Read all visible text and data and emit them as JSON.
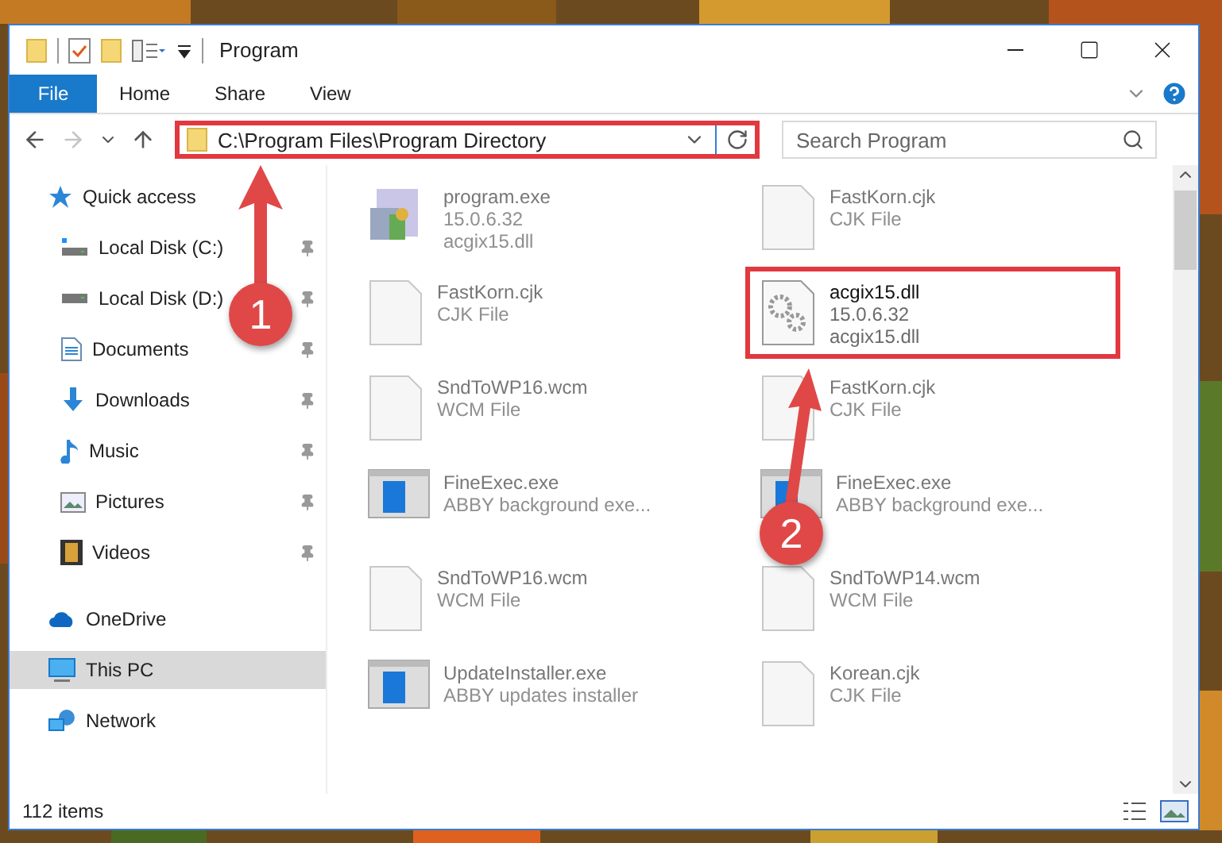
{
  "window": {
    "title": "Program"
  },
  "ribbon": {
    "tabs": [
      {
        "label": "File",
        "selected": true
      },
      {
        "label": "Home",
        "selected": false
      },
      {
        "label": "Share",
        "selected": false
      },
      {
        "label": "View",
        "selected": false
      }
    ]
  },
  "address": {
    "path": "C:\\Program Files\\Program Directory",
    "highlighted": true,
    "forward_disabled": true
  },
  "search": {
    "placeholder": "Search Program"
  },
  "sidebar": {
    "items": [
      {
        "label": "Quick access",
        "kind": "star",
        "selected": false,
        "children": [
          {
            "label": "Local Disk (C:)",
            "kind": "disk-win",
            "pinned": true,
            "selected": false
          },
          {
            "label": "Local Disk (D:)",
            "kind": "disk",
            "pinned": true,
            "selected": false
          },
          {
            "label": "Documents",
            "kind": "docs",
            "pinned": true,
            "selected": false
          },
          {
            "label": "Downloads",
            "kind": "download",
            "pinned": true,
            "selected": false
          },
          {
            "label": "Music",
            "kind": "music",
            "pinned": true,
            "selected": false
          },
          {
            "label": "Pictures",
            "kind": "pictures",
            "pinned": true,
            "selected": false
          },
          {
            "label": "Videos",
            "kind": "videos",
            "pinned": true,
            "selected": false
          }
        ]
      },
      {
        "label": "OneDrive",
        "kind": "cloud",
        "selected": false
      },
      {
        "label": "This PC",
        "kind": "pc",
        "selected": true
      },
      {
        "label": "Network",
        "kind": "network",
        "selected": false
      }
    ]
  },
  "files": [
    {
      "name": "program.exe",
      "lines": [
        "15.0.6.32",
        "acgix15.dll"
      ],
      "kind": "installer",
      "dimmed": true,
      "highlighted": false
    },
    {
      "name": "FastKorn.cjk",
      "lines": [
        "CJK File"
      ],
      "kind": "blank",
      "dimmed": true,
      "highlighted": false
    },
    {
      "name": "FastKorn.cjk",
      "lines": [
        "CJK File"
      ],
      "kind": "blank",
      "dimmed": true,
      "highlighted": false
    },
    {
      "name": "acgix15.dll",
      "lines": [
        "15.0.6.32",
        "acgix15.dll"
      ],
      "kind": "gear",
      "dimmed": false,
      "highlighted": true
    },
    {
      "name": "SndToWP16.wcm",
      "lines": [
        "WCM File"
      ],
      "kind": "blank",
      "dimmed": true,
      "highlighted": false
    },
    {
      "name": "FastKorn.cjk",
      "lines": [
        "CJK File"
      ],
      "kind": "blank",
      "dimmed": true,
      "highlighted": false
    },
    {
      "name": "FineExec.exe",
      "lines": [
        "ABBY background exe..."
      ],
      "kind": "app",
      "dimmed": true,
      "highlighted": false
    },
    {
      "name": "FineExec.exe",
      "lines": [
        "ABBY background exe..."
      ],
      "kind": "app",
      "dimmed": true,
      "highlighted": false
    },
    {
      "name": "SndToWP16.wcm",
      "lines": [
        "WCM File"
      ],
      "kind": "blank",
      "dimmed": true,
      "highlighted": false
    },
    {
      "name": "SndToWP14.wcm",
      "lines": [
        "WCM File"
      ],
      "kind": "blank",
      "dimmed": true,
      "highlighted": false
    },
    {
      "name": "UpdateInstaller.exe",
      "lines": [
        "ABBY updates installer"
      ],
      "kind": "app",
      "dimmed": true,
      "highlighted": false
    },
    {
      "name": "Korean.cjk",
      "lines": [
        "CJK File"
      ],
      "kind": "blank",
      "dimmed": true,
      "highlighted": false
    }
  ],
  "status_bar": {
    "count": "112 items"
  },
  "annotations": [
    {
      "label": "1"
    },
    {
      "label": "2"
    }
  ]
}
